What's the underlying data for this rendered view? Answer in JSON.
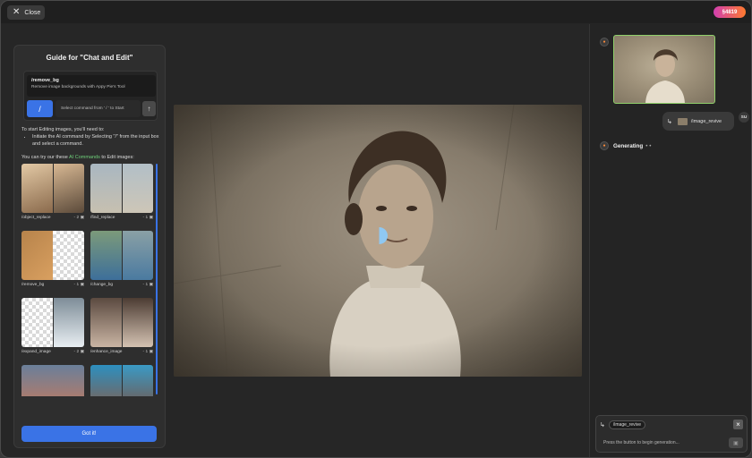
{
  "topbar": {
    "close_label": "Close",
    "close_icon": "x-icon",
    "credits": "§4819"
  },
  "guide": {
    "title": "Guide for \"Chat and Edit\"",
    "suggest_command": "/remove_bg",
    "suggest_desc": "Remove image backgrounds with Appy Pie's Tool",
    "slash_label": "/",
    "input_placeholder": "Select command from ' / ' to Start",
    "intro": "To start Editing images, you'll need to:",
    "bullet": "Initiate the AI command by Selecting \"/\" from the input box and select a command.",
    "try_prefix": "You can try our these ",
    "try_highlight": "AI Commands",
    "try_suffix": " to Edit images:",
    "cards": [
      {
        "name": "/object_replace",
        "cost": "- 2 ▣"
      },
      {
        "name": "/find_replace",
        "cost": "- 1 ▣"
      },
      {
        "name": "/remove_bg",
        "cost": "- 1 ▣"
      },
      {
        "name": "/change_bg",
        "cost": "- 1 ▣"
      },
      {
        "name": "/expand_image",
        "cost": "- 2 ▣"
      },
      {
        "name": "/enhance_image",
        "cost": "- 1 ▣"
      },
      {
        "name": "",
        "cost": ""
      },
      {
        "name": "",
        "cost": ""
      }
    ],
    "got_it": "Got it!"
  },
  "chat": {
    "bot_icon": "appy-pie-logo-icon",
    "user_command": "/image_revive",
    "user_initials": "SU",
    "status": "Generating",
    "status_dots": "• •",
    "input_tag": "/image_revive",
    "input_hint": "Press the button to begin generation..."
  },
  "colors": {
    "accent": "#3a73e6",
    "highlight": "#6fd07a",
    "border_selected": "#8fd06a"
  }
}
